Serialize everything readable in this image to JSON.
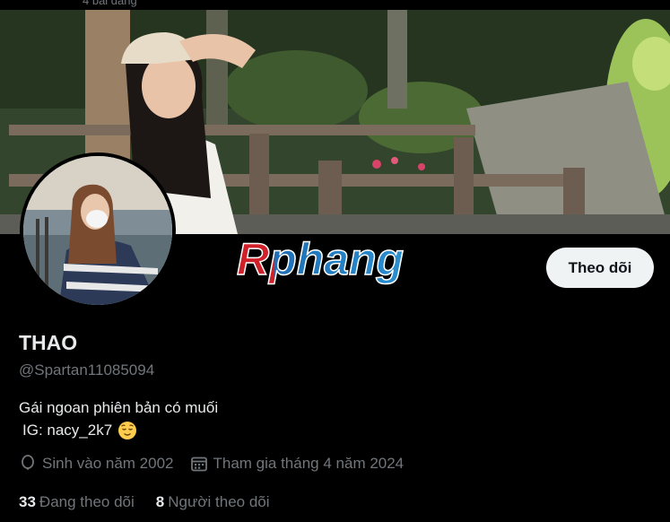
{
  "header": {
    "post_count": "4 bài đăng"
  },
  "watermark": {
    "text": "Rphang",
    "color_left": "#d0202a",
    "color_right": "#1f6fb5"
  },
  "follow_button": {
    "label": "Theo dõi"
  },
  "profile": {
    "name": "THAO",
    "handle": "@Spartan11085094",
    "bio_line1": "Gái ngoan phiên bản có muối",
    "bio_line2": "IG: nacy_2k7",
    "bio_emoji": "relieved-face-icon",
    "birthday": "Sinh vào năm 2002",
    "joined": "Tham gia tháng 4 năm 2024"
  },
  "stats": {
    "following_count": "33",
    "following_label": "Đang theo dõi",
    "followers_count": "8",
    "followers_label": "Người theo dõi"
  },
  "colors": {
    "background": "#000000",
    "text": "#e7e9ea",
    "muted": "#71767b",
    "button_bg": "#eff3f4"
  }
}
